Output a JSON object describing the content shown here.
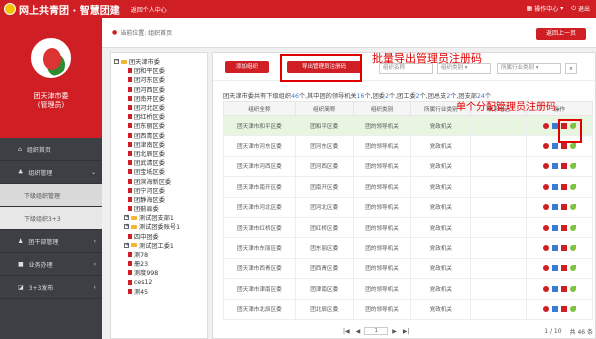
{
  "header": {
    "title": "网上共青团 · 智慧团建",
    "subtitle": "返回个人中心",
    "right": [
      "操作中心",
      "退出"
    ]
  },
  "sidebar": {
    "profile_name_line1": "团天津市委",
    "profile_name_line2": "(管理员)",
    "items": [
      {
        "label": "组织首页",
        "type": "main"
      },
      {
        "label": "组织管理",
        "type": "main"
      },
      {
        "label": "下级组织管理",
        "type": "sub"
      },
      {
        "label": "下级组织3+3",
        "type": "sub"
      },
      {
        "label": "团干部管理",
        "type": "main"
      },
      {
        "label": "业务办理",
        "type": "main"
      },
      {
        "label": "3+3发布",
        "type": "main"
      }
    ]
  },
  "breadcrumb": "当前位置: 组织首页",
  "back_button": "返回上一页",
  "tree": {
    "root": "团天津市委",
    "items": [
      "团和平区委",
      "团河东区委",
      "团河西区委",
      "团南开区委",
      "团河北区委",
      "团红桥区委",
      "团东丽区委",
      "团西青区委",
      "团津南区委",
      "团北辰区委",
      "团武清区委",
      "团宝坻区委",
      "团滨海新区委",
      "团宁河区委",
      "团静海区委",
      "团蓟县委",
      "测试团支部1",
      "测试团委账号1",
      "四中团委",
      "测试团工委1",
      "测78",
      "册23",
      "测度998",
      "ces12",
      "测45"
    ]
  },
  "toolbar": {
    "add_button": "添加组织",
    "export_button": "导出管理员注册码",
    "select_name": "组织名称",
    "select_category": "组织类别",
    "select_industry": "所属行业类别"
  },
  "summary": {
    "prefix": "团天津市委共有下级组织",
    "total": "46",
    "part1": "个,其中团的领导机关",
    "leaders": "16",
    "part2": "个,团委",
    "tw": "2",
    "part3": "个,团工委",
    "tgw": "2",
    "part4": "个,团总支",
    "tzz": "2",
    "part5": "个,团支部",
    "tzb": "24",
    "part6": "个"
  },
  "table": {
    "headers": [
      "组织全称",
      "组织简称",
      "组织类别",
      "所属行业类别",
      "联系电话",
      "操作"
    ],
    "rows": [
      [
        "团天津市和平区委",
        "团和平区委",
        "团的领导机关",
        "党政机关",
        ""
      ],
      [
        "团天津市河东区委",
        "团河东区委",
        "团的领导机关",
        "党政机关",
        ""
      ],
      [
        "团天津市河西区委",
        "团河西区委",
        "团的领导机关",
        "党政机关",
        ""
      ],
      [
        "团天津市南开区委",
        "团南开区委",
        "团的领导机关",
        "党政机关",
        ""
      ],
      [
        "团天津市河北区委",
        "团河北区委",
        "团的领导机关",
        "党政机关",
        ""
      ],
      [
        "团天津市红桥区委",
        "团红桥区委",
        "团的领导机关",
        "党政机关",
        ""
      ],
      [
        "团天津市东丽区委",
        "团东丽区委",
        "团的领导机关",
        "党政机关",
        ""
      ],
      [
        "团天津市西青区委",
        "团西青区委",
        "团的领导机关",
        "党政机关",
        ""
      ],
      [
        "团天津市津南区委",
        "团津南区委",
        "团的领导机关",
        "党政机关",
        ""
      ],
      [
        "团天津市北辰区委",
        "团北辰区委",
        "团的领导机关",
        "党政机关",
        ""
      ]
    ]
  },
  "pager": {
    "page_input": "1",
    "page_info": "1 / 10",
    "total": "共 46 条"
  },
  "annotations": {
    "batch": "批量导出管理员注册码",
    "single": "单个分配管理员注册码"
  }
}
